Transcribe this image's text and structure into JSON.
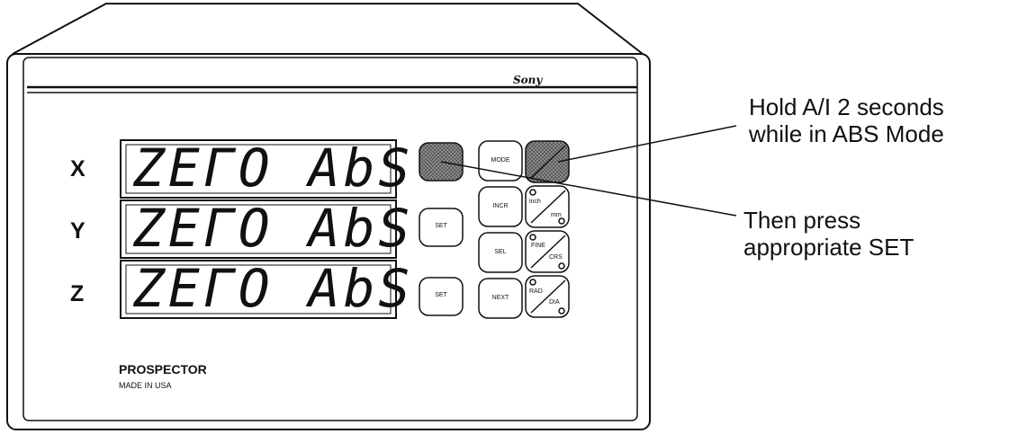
{
  "axes": [
    {
      "label": "X",
      "display": "ZEГO AbS"
    },
    {
      "label": "Y",
      "display": "ZEГO AbS"
    },
    {
      "label": "Z",
      "display": "ZEГO AbS"
    }
  ],
  "keys": {
    "mode": "MODE",
    "incr": "INCR",
    "sel": "SEL",
    "next": "NEXT",
    "set_y": "SET",
    "set_z": "SET",
    "unit_a": "inch",
    "unit_b": "mm",
    "res_a": "FINE",
    "res_b": "CRS",
    "meas_a": "RAD",
    "meas_b": "DIA"
  },
  "brand": {
    "logo": "Sony",
    "name": "PROSPECTOR",
    "origin": "MADE IN USA"
  },
  "callouts": {
    "top_line1": "Hold A/I 2 seconds",
    "top_line2": "while in ABS Mode",
    "bottom_line1": "Then press",
    "bottom_line2": "appropriate SET"
  },
  "colors": {
    "ink": "#111111",
    "background": "#ffffff",
    "highlight_fill": "#777777"
  }
}
